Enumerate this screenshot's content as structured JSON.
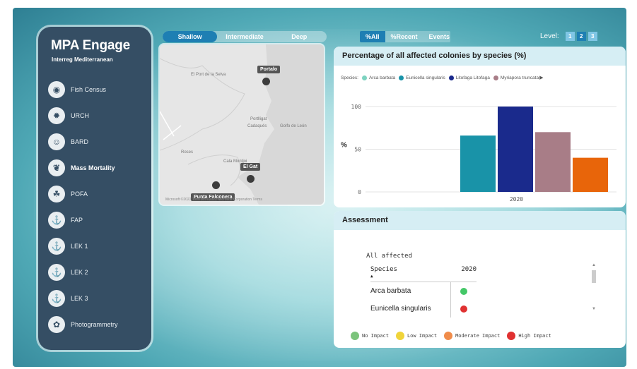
{
  "app": {
    "title": "MPA Engage",
    "subtitle": "Interreg Mediterranean"
  },
  "sidebar": {
    "items": [
      {
        "label": "Fish Census",
        "icon": "fish-icon",
        "active": false
      },
      {
        "label": "URCH",
        "icon": "urchin-icon",
        "active": false
      },
      {
        "label": "BARD",
        "icon": "diver-icon",
        "active": false
      },
      {
        "label": "Mass Mortality",
        "icon": "coral-icon",
        "active": true
      },
      {
        "label": "POFA",
        "icon": "seagrass-icon",
        "active": false
      },
      {
        "label": "FAP",
        "icon": "anchor-icon",
        "active": false
      },
      {
        "label": "LEK 1",
        "icon": "boat-icon",
        "active": false
      },
      {
        "label": "LEK 2",
        "icon": "boat-icon",
        "active": false
      },
      {
        "label": "LEK 3",
        "icon": "boat-icon",
        "active": false
      },
      {
        "label": "Photogrammetry",
        "icon": "photogrammetry-icon",
        "active": false
      }
    ]
  },
  "depth_tabs": [
    {
      "label": "Shallow",
      "active": true
    },
    {
      "label": "Intermediate",
      "active": false
    },
    {
      "label": "Deep",
      "active": false
    }
  ],
  "metric_tabs": [
    {
      "label": "%All",
      "active": true
    },
    {
      "label": "%Recent",
      "active": false
    },
    {
      "label": "Events",
      "active": false
    }
  ],
  "level": {
    "label": "Level:",
    "options": [
      "1",
      "2",
      "3"
    ],
    "selected": "2"
  },
  "map": {
    "places": [
      "El Port de la Selva",
      "Portlligat",
      "Cadaqués",
      "Golfo de León",
      "Roses",
      "Cala Montjoi"
    ],
    "markers": [
      {
        "label": "Portalo"
      },
      {
        "label": "El Gat"
      },
      {
        "label": "Punta Falconera"
      }
    ],
    "attribution": "Microsoft ©2022 TomTom ©2022 Microsoft Corporation Terms"
  },
  "chart": {
    "title": "Percentage of all affected colonies by species (%)",
    "legend_prefix": "Species:"
  },
  "chart_data": {
    "type": "bar",
    "title": "Percentage of all affected colonies by species (%)",
    "xlabel": "",
    "ylabel": "%",
    "categories": [
      "2020"
    ],
    "series": [
      {
        "name": "Arca barbata",
        "values": [
          0
        ],
        "color": "#7dd3c0"
      },
      {
        "name": "Eunicella singularis",
        "values": [
          66
        ],
        "color": "#1993a8"
      },
      {
        "name": "Litofaga Litofaga",
        "values": [
          100
        ],
        "color": "#1a2a8c"
      },
      {
        "name": "Myriapora truncata",
        "values": [
          70
        ],
        "color": "#a87d87"
      },
      {
        "name": "",
        "values": [
          40
        ],
        "color": "#e8650a"
      }
    ],
    "yticks": [
      0,
      50,
      100
    ],
    "ylim": [
      0,
      100
    ],
    "grid": true,
    "legend_position": "top"
  },
  "assessment": {
    "header": "Assessment",
    "table_title": "All affected",
    "columns": [
      "Species",
      "2020"
    ],
    "rows": [
      {
        "species": "Arca barbata",
        "status": "#44c767"
      },
      {
        "species": "Eunicella singularis",
        "status": "#e03131"
      }
    ],
    "impact_legend": [
      {
        "label": "No Impact",
        "color": "#7cc47c"
      },
      {
        "label": "Low Impact",
        "color": "#f0d43a"
      },
      {
        "label": "Moderate Impact",
        "color": "#f08c4a"
      },
      {
        "label": "High Impact",
        "color": "#e03131"
      }
    ]
  }
}
